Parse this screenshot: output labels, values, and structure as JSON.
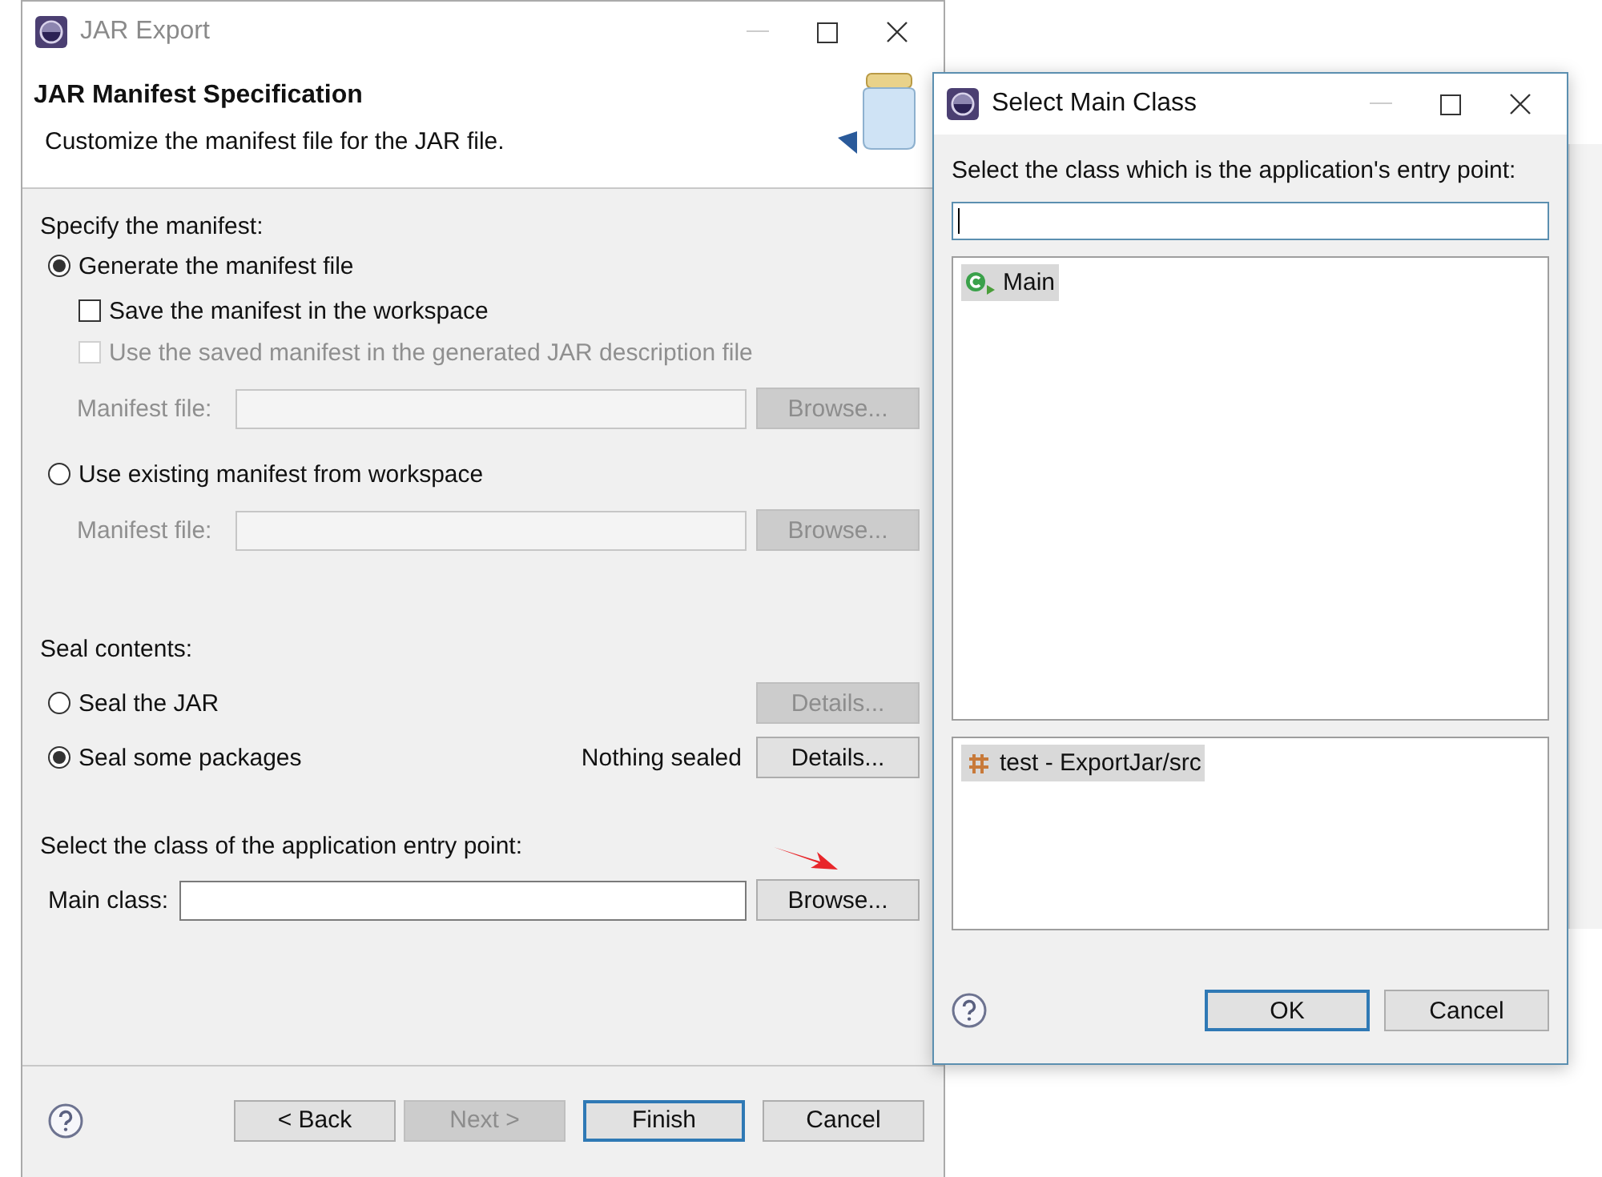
{
  "jar_export": {
    "title": "JAR Export",
    "header": {
      "title": "JAR Manifest Specification",
      "description": "Customize the manifest file for the JAR file."
    },
    "manifest": {
      "heading": "Specify the manifest:",
      "generate": {
        "label": "Generate the manifest file",
        "selected": true,
        "save": {
          "label": "Save the manifest in the workspace",
          "checked": false,
          "disabled": false
        },
        "use_saved": {
          "label": "Use the saved manifest in the generated JAR description file",
          "checked": false,
          "disabled": true
        },
        "file_field": {
          "label": "Manifest file:",
          "button": "Browse...",
          "disabled": true
        }
      },
      "existing": {
        "label": "Use existing manifest from workspace",
        "selected": false,
        "file_field": {
          "label": "Manifest file:",
          "button": "Browse...",
          "disabled": true
        }
      }
    },
    "seal": {
      "heading": "Seal contents:",
      "options": [
        {
          "label": "Seal the JAR",
          "selected": false,
          "button": {
            "label": "Details...",
            "disabled": true
          }
        },
        {
          "label": "Seal some packages",
          "selected": true,
          "status": "Nothing sealed",
          "button": {
            "label": "Details...",
            "disabled": false
          }
        }
      ]
    },
    "entry": {
      "heading": "Select the class of the application entry point:",
      "field_label": "Main class:",
      "button": "Browse..."
    },
    "buttons": [
      {
        "label": "< Back",
        "disabled": false,
        "default": false
      },
      {
        "label": "Next >",
        "disabled": true,
        "default": false
      },
      {
        "label": "Finish",
        "disabled": false,
        "default": true
      },
      {
        "label": "Cancel",
        "disabled": false,
        "default": false
      }
    ]
  },
  "select_main_class": {
    "title": "Select Main Class",
    "prompt": "Select the class which is the application's entry point:",
    "classes": [
      {
        "label": "Main",
        "selected": true
      }
    ],
    "packages": [
      {
        "label": "test - ExportJar/src",
        "selected": true
      }
    ],
    "buttons": [
      {
        "label": "OK",
        "default": true
      },
      {
        "label": "Cancel",
        "default": false
      }
    ]
  }
}
